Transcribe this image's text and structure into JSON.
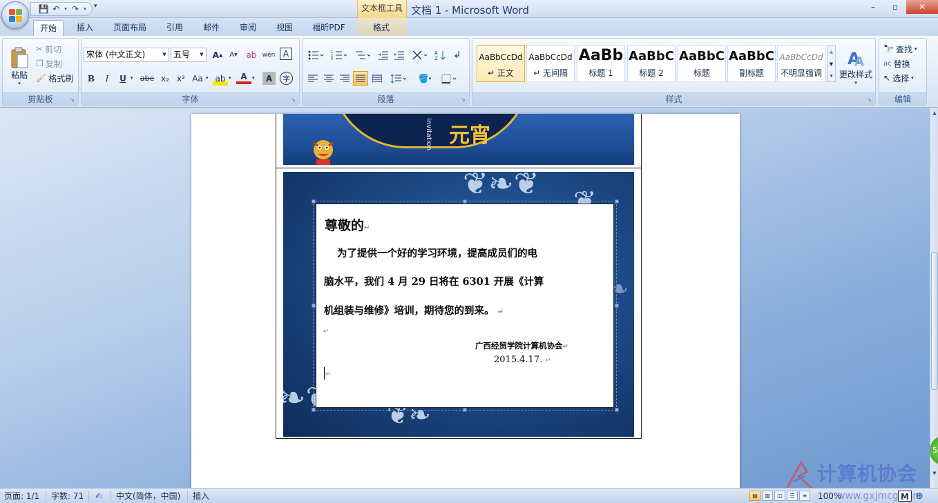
{
  "window": {
    "doc_title": "文档 1 - Microsoft Word",
    "context_tool": "文本框工具",
    "controls": {
      "minimize": "–",
      "restore": "▫",
      "close": "✕"
    }
  },
  "qat": {
    "save": "💾",
    "undo": "↶",
    "redo": "↷",
    "more": "▾"
  },
  "tabs": [
    {
      "label": "开始",
      "active": true
    },
    {
      "label": "插入"
    },
    {
      "label": "页面布局"
    },
    {
      "label": "引用"
    },
    {
      "label": "邮件"
    },
    {
      "label": "审阅"
    },
    {
      "label": "视图"
    },
    {
      "label": "福昕PDF"
    },
    {
      "label": "格式"
    }
  ],
  "clipboard": {
    "paste": "粘贴",
    "cut": "剪切",
    "copy": "复制",
    "format_painter": "格式刷",
    "label": "剪贴板"
  },
  "font": {
    "name": "宋体 (中文正文)",
    "size": "五号",
    "grow": "A",
    "shrink": "A",
    "clear": "ab",
    "phonetic": "wén",
    "border_char": "A",
    "bold": "B",
    "italic": "I",
    "underline": "U",
    "strike": "abe",
    "subscript": "x₂",
    "superscript": "x²",
    "change_case": "Aa",
    "highlight": "ab",
    "font_color": "A",
    "shade_char": "A",
    "enclose": "字",
    "label": "字体"
  },
  "paragraph": {
    "label": "段落"
  },
  "styles": {
    "items": [
      {
        "sample": "AaBbCcDd",
        "name": "↵ 正文",
        "selected": true
      },
      {
        "sample": "AaBbCcDd",
        "name": "↵ 无间隔"
      },
      {
        "sample": "AaBb",
        "name": "标题 1"
      },
      {
        "sample": "AaBbC",
        "name": "标题 2"
      },
      {
        "sample": "AaBbC",
        "name": "标题"
      },
      {
        "sample": "AaBbC",
        "name": "副标题"
      },
      {
        "sample": "AaBbCcDd",
        "name": "不明显强调"
      }
    ],
    "change_styles": "更改样式",
    "label": "样式"
  },
  "editing": {
    "find": "查找",
    "replace": "替换",
    "select": "选择",
    "label": "编辑"
  },
  "document": {
    "banner_vertical_text": "Invitation",
    "banner_gold_text": "元宵",
    "invitation": {
      "salutation": "尊敬的",
      "body_line1": "为了提供一个好的学习环境，提高成员们的电",
      "body_line2": "脑水平，我们 4 月 29 日将在 6301 开展《计算",
      "body_line3": "机组装与维修》培训，期待您的到来。",
      "signature": "广西经贸学院计算机协会",
      "date": "2015.4.17.",
      "paragraph_mark": "↵"
    }
  },
  "statusbar": {
    "page": "页面: 1/1",
    "words": "字数: 71",
    "language": "中文(简体，中国)",
    "mode": "插入",
    "zoom": "100%"
  },
  "watermark": {
    "text": "计算机协会",
    "url": "www.gxjmcg.com",
    "badge": "M"
  },
  "colors": {
    "accent": "#2b579a",
    "ribbon": "#dfe9f5",
    "invite_bg": "#1d4a86",
    "gold": "#f2c232"
  }
}
